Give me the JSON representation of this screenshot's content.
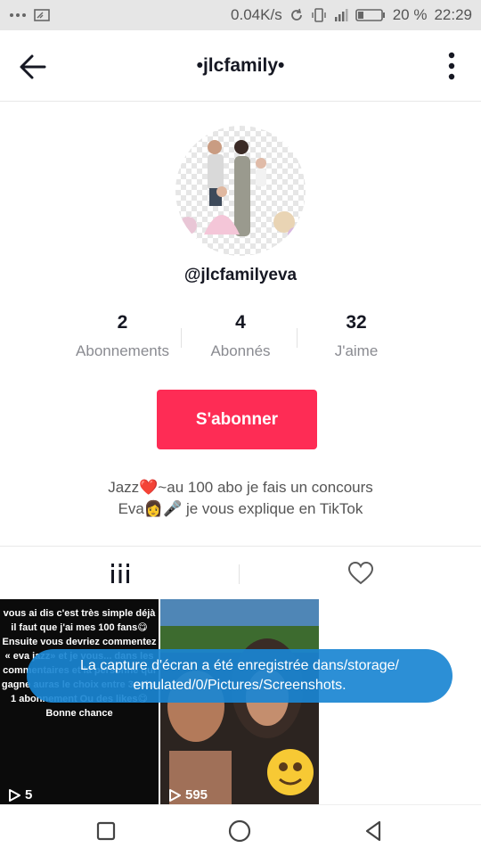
{
  "status": {
    "left_icons": [
      "dots-icon",
      "cast-icon"
    ],
    "speed": "0.04K/s",
    "battery": "20 %",
    "time": "22:29"
  },
  "header": {
    "title": "•jlcfamily•"
  },
  "profile": {
    "handle": "@jlcfamilyeva",
    "stats": [
      {
        "value": "2",
        "label": "Abonnements"
      },
      {
        "value": "4",
        "label": "Abonnés"
      },
      {
        "value": "32",
        "label": "J'aime"
      }
    ],
    "follow_label": "S'abonner",
    "bio_line1": "Jazz❤️~au 100 abo je fais un concours",
    "bio_line2": "Eva👩🎤 je vous explique en TikTok"
  },
  "videos": [
    {
      "caption": "vous ai dis c'est très simple déjà il faut que j'ai mes 100 fans😋 Ensuite vous devriez commentez « eva jazz» et je vous... dans les commentaires et la personne qui gagne auras le choix entre 3pubs 1 abonnement Ou des likes😋 Bonne chance",
      "views": "5"
    },
    {
      "caption": "",
      "views": "595"
    }
  ],
  "toast": {
    "line1": "La capture d'écran a été enregistrée dans/storage/",
    "line2": "emulated/0/Pictures/Screenshots."
  },
  "colors": {
    "accent": "#fe2c55",
    "toast": "#1a86d2"
  }
}
